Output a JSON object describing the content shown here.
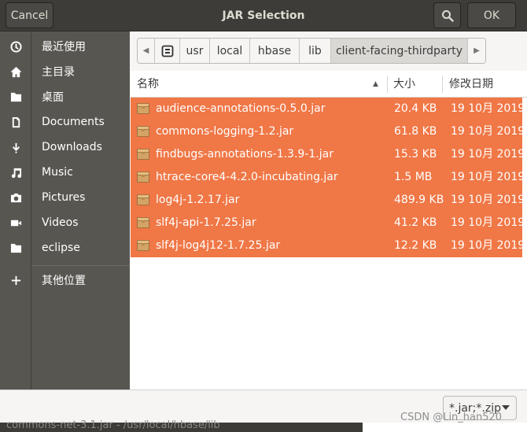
{
  "header": {
    "cancel_label": "Cancel",
    "title": "JAR Selection",
    "ok_label": "OK"
  },
  "sidebar": {
    "items": [
      {
        "label": "最近使用",
        "icon": "clock-icon"
      },
      {
        "label": "主目录",
        "icon": "home-icon"
      },
      {
        "label": "桌面",
        "icon": "folder-icon"
      },
      {
        "label": "Documents",
        "icon": "document-icon"
      },
      {
        "label": "Downloads",
        "icon": "download-icon"
      },
      {
        "label": "Music",
        "icon": "music-icon"
      },
      {
        "label": "Pictures",
        "icon": "camera-icon"
      },
      {
        "label": "Videos",
        "icon": "video-icon"
      },
      {
        "label": "eclipse",
        "icon": "folder-icon"
      }
    ],
    "other_locations": {
      "label": "其他位置",
      "icon": "plus-icon"
    }
  },
  "pathbar": {
    "segments": [
      "usr",
      "local",
      "hbase",
      "lib",
      "client-facing-thirdparty"
    ]
  },
  "columns": {
    "name": "名称",
    "size": "大小",
    "modified": "修改日期"
  },
  "files": [
    {
      "name": "audience-annotations-0.5.0.jar",
      "size": "20.4 KB",
      "date": "19 10月 2019"
    },
    {
      "name": "commons-logging-1.2.jar",
      "size": "61.8 KB",
      "date": "19 10月 2019"
    },
    {
      "name": "findbugs-annotations-1.3.9-1.jar",
      "size": "15.3 KB",
      "date": "19 10月 2019"
    },
    {
      "name": "htrace-core4-4.2.0-incubating.jar",
      "size": "1.5 MB",
      "date": "19 10月 2019"
    },
    {
      "name": "log4j-1.2.17.jar",
      "size": "489.9 KB",
      "date": "19 10月 2019"
    },
    {
      "name": "slf4j-api-1.7.25.jar",
      "size": "41.2 KB",
      "date": "19 10月 2019"
    },
    {
      "name": "slf4j-log4j12-1.7.25.jar",
      "size": "12.2 KB",
      "date": "19 10月 2019"
    }
  ],
  "filter": {
    "selected": "*.jar;*.zip"
  },
  "background": {
    "text": "commons-net-3.1.jar - /usr/local/hbase/lib"
  },
  "watermark": "CSDN @Lin_han520",
  "colors": {
    "selection": "#f07746",
    "headerbar": "#3d3c38",
    "sidebar": "#575651"
  }
}
